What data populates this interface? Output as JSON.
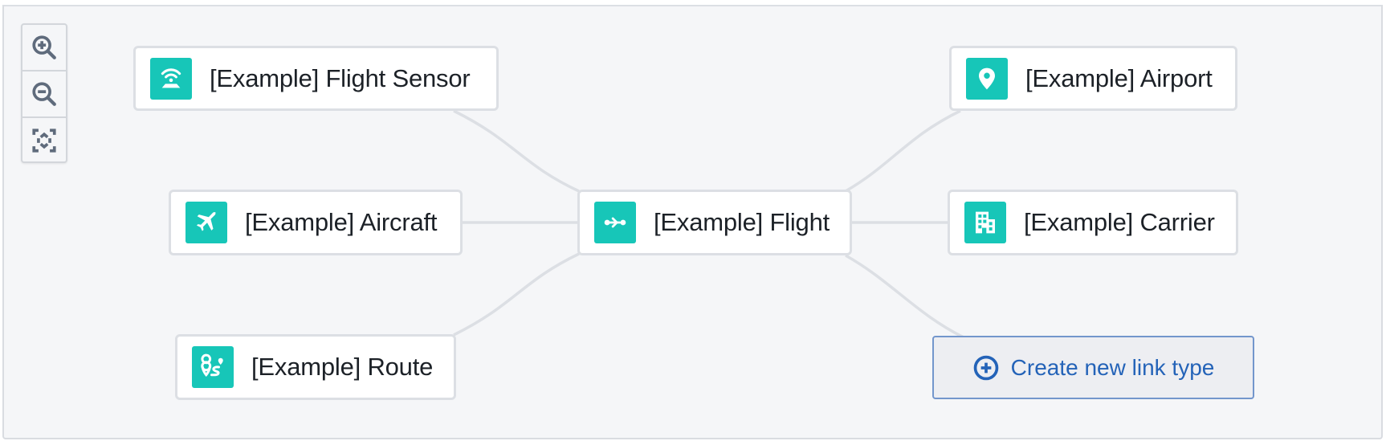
{
  "graph": {
    "zoom_controls": [
      {
        "name": "zoom-in-button",
        "icon": "zoom-in-icon"
      },
      {
        "name": "zoom-out-button",
        "icon": "zoom-out-icon"
      },
      {
        "name": "fit-to-view-button",
        "icon": "fit-view-icon"
      }
    ],
    "center_node": {
      "label": "[Example] Flight",
      "icon": "flight-icon"
    },
    "nodes": [
      {
        "label": "[Example] Flight Sensor",
        "icon": "sensor-icon"
      },
      {
        "label": "[Example] Aircraft",
        "icon": "airplane-icon"
      },
      {
        "label": "[Example] Route",
        "icon": "route-icon"
      },
      {
        "label": "[Example] Airport",
        "icon": "map-pin-icon"
      },
      {
        "label": "[Example] Carrier",
        "icon": "building-icon"
      }
    ],
    "create_button": {
      "label": "Create new link type",
      "icon": "plus-circle-icon"
    },
    "colors": {
      "icon_background": "#17c6b8",
      "accent_blue": "#2463b8",
      "canvas_background": "#f5f6f8"
    }
  }
}
